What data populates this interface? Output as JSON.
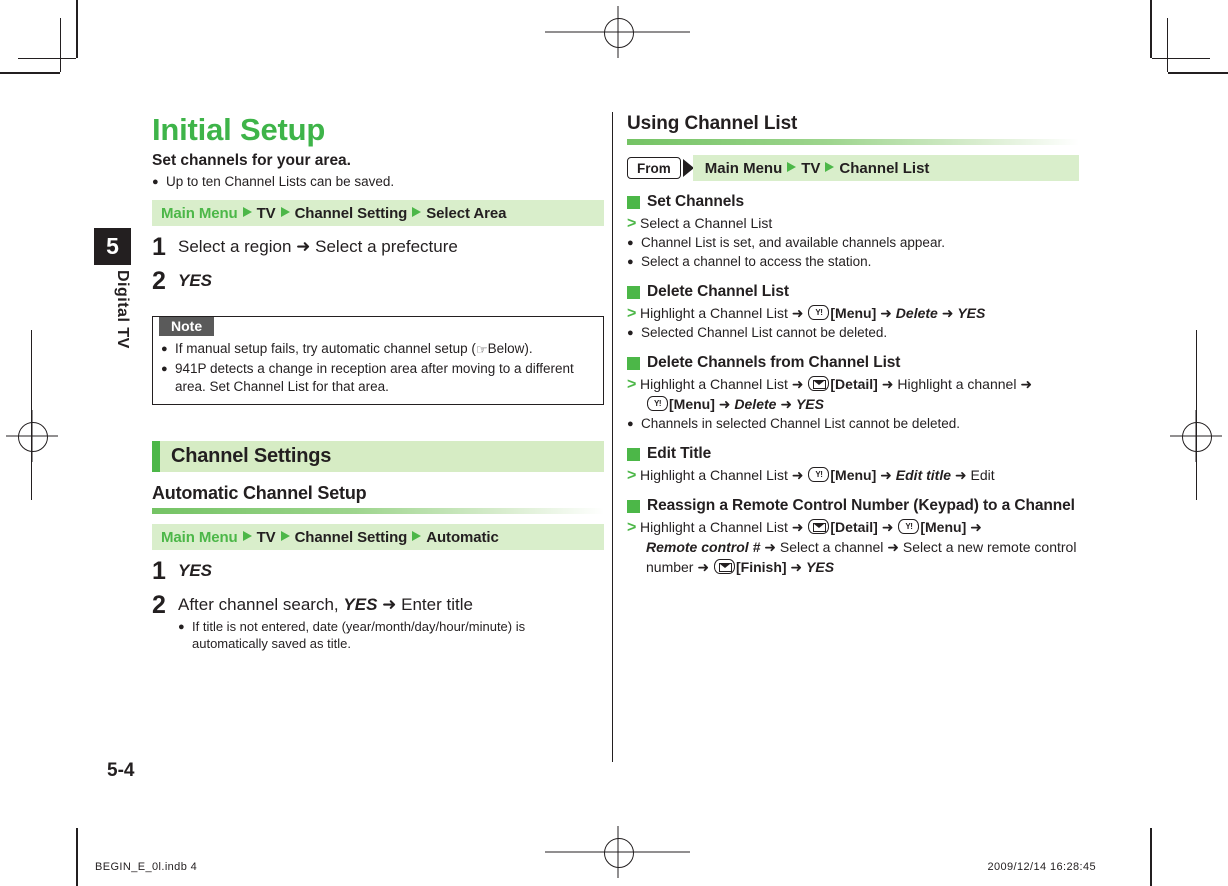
{
  "side_tab": {
    "number": "5",
    "label": "Digital TV"
  },
  "page_number": "5-4",
  "production_footer": {
    "file": "BEGIN_E_0l.indb    4",
    "datetime": "2009/12/14    16:28:45"
  },
  "left_column": {
    "title": "Initial Setup",
    "lead": "Set channels for your area.",
    "lead_bullet": "Up to ten Channel Lists can be saved.",
    "path1": {
      "main_menu": "Main Menu",
      "items": [
        "TV",
        "Channel Setting",
        "Select Area"
      ]
    },
    "steps1": [
      {
        "n": "1",
        "text_a": "Select a region",
        "arrow": "➜",
        "text_b": "Select a prefecture"
      },
      {
        "n": "2",
        "italic": "YES"
      }
    ],
    "note": {
      "caption": "Note",
      "items": [
        {
          "pre": "If manual setup fails, try automatic channel setup (",
          "icon": "pointing-hand",
          "mid": "Below).",
          "post": ""
        },
        {
          "pre": "941P detects a change in reception area after moving to a different area. Set Channel List for that area.",
          "icon": "",
          "mid": "",
          "post": ""
        }
      ]
    },
    "section_header": "Channel Settings",
    "sub_header": "Automatic Channel Setup",
    "path2": {
      "main_menu": "Main Menu",
      "items": [
        "TV",
        "Channel Setting",
        "Automatic"
      ]
    },
    "steps2": [
      {
        "n": "1",
        "italic": "YES"
      },
      {
        "n": "2",
        "text_a": "After channel search,",
        "italic": "YES",
        "arrow": "➜",
        "text_b": "Enter title",
        "bullet": "If title is not entered, date (year/month/day/hour/minute) is automatically saved as title."
      }
    ]
  },
  "right_column": {
    "title": "Using Channel List",
    "from_label": "From",
    "from_path": {
      "main_menu": "Main Menu",
      "items": [
        "TV",
        "Channel List"
      ]
    },
    "blocks": [
      {
        "heading": "Set Channels",
        "gt_lines": [
          {
            "text": "Select a Channel List"
          }
        ],
        "dots": [
          "Channel List is set, and available channels appear.",
          "Select a channel to access the station."
        ]
      },
      {
        "heading": "Delete Channel List",
        "gt_lines": [
          {
            "text": "Highlight a Channel List ➜ |key-yahoo|[Menu] ➜ |i|Delete|/i| ➜ |i|YES|/i|"
          }
        ],
        "dots": [
          "Selected Channel List cannot be deleted."
        ]
      },
      {
        "heading": "Delete Channels from Channel List",
        "gt_lines": [
          {
            "text": "Highlight a Channel List ➜ |key-mail|[Detail] ➜ Highlight a channel ➜"
          },
          {
            "text": "|key-yahoo|[Menu] ➜ |i|Delete|/i| ➜ |i|YES|/i|",
            "indent": true
          }
        ],
        "dots": [
          "Channels in selected Channel List cannot be deleted."
        ]
      },
      {
        "heading": "Edit Title",
        "gt_lines": [
          {
            "text": "Highlight a Channel List ➜ |key-yahoo|[Menu] ➜ |i|Edit title|/i| ➜ Edit"
          }
        ],
        "dots": []
      },
      {
        "heading": "Reassign a Remote Control Number (Keypad) to a Channel",
        "gt_lines": [
          {
            "text": "Highlight a Channel List ➜ |key-mail|[Detail] ➜ |key-yahoo|[Menu] ➜"
          },
          {
            "text": "|i|Remote control #|/i| ➜ Select a channel ➜ Select a new remote control",
            "indent": true
          },
          {
            "text": "number ➜ |key-mail|[Finish] ➜ |i|YES|/i|",
            "indent": true
          }
        ],
        "dots": []
      }
    ]
  },
  "colors": {
    "green": "#4cb748",
    "green_title": "#3eb449",
    "path_bg": "#d9eecb",
    "sec_bg": "#d6ecc4",
    "ink": "#231f20",
    "note_cap": "#5a5a5a"
  }
}
